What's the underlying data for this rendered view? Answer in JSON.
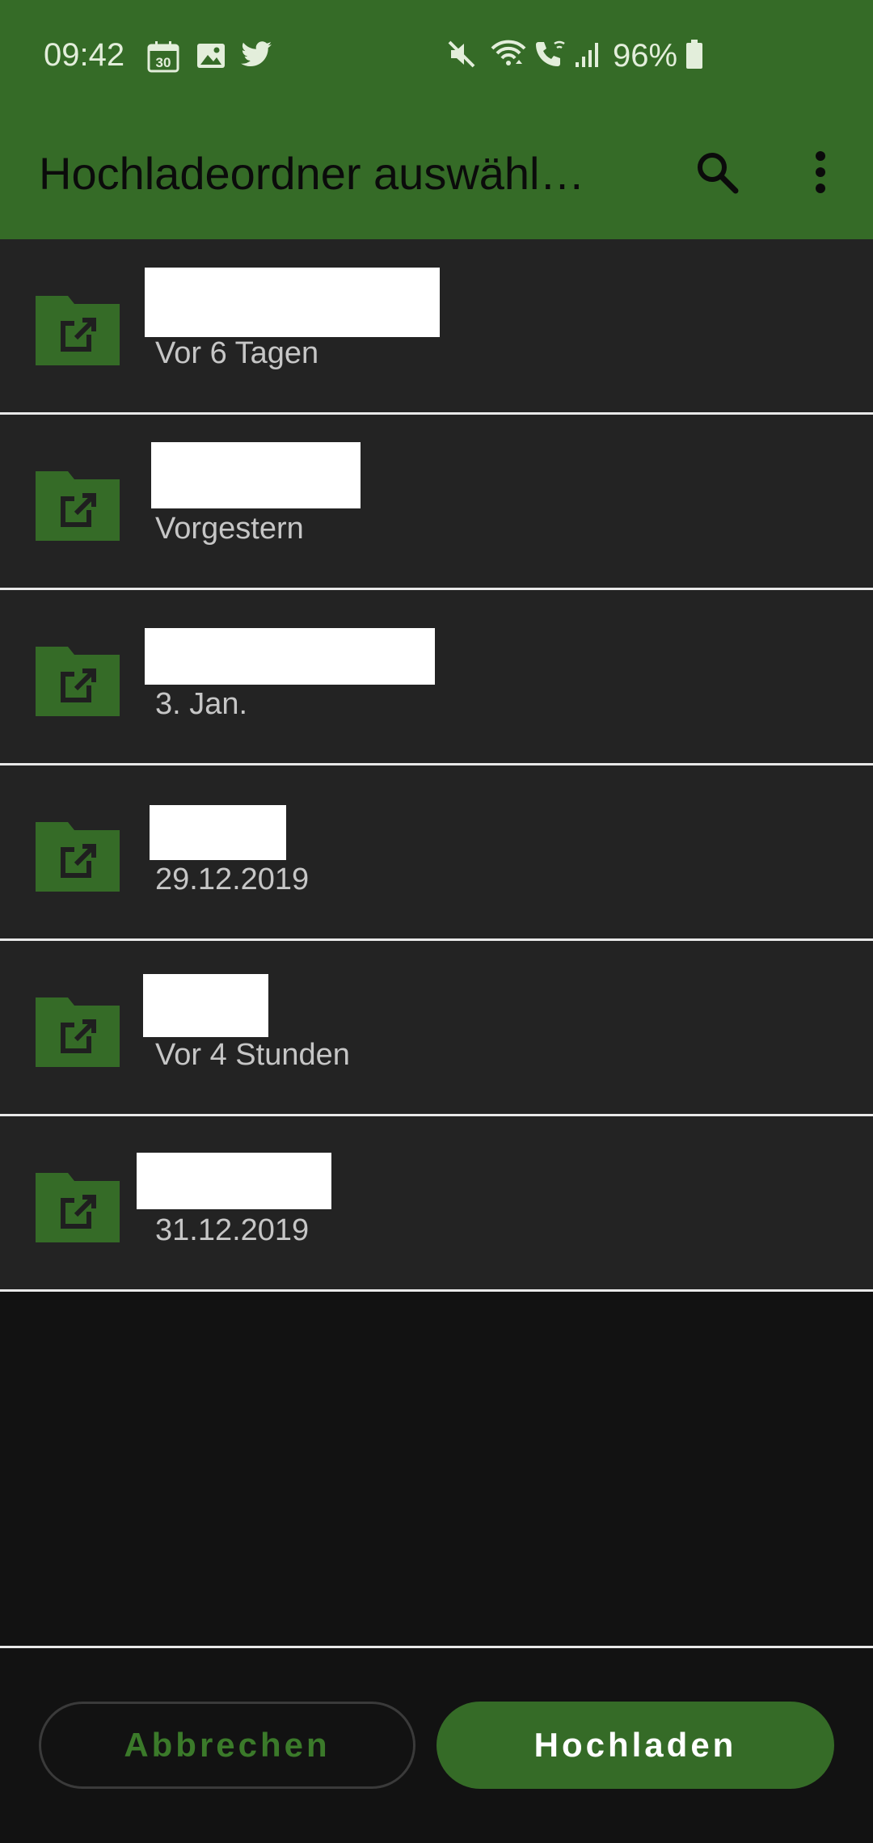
{
  "status_bar": {
    "time": "09:42",
    "calendar_day": "30",
    "battery": "96%",
    "left_icons": [
      "calendar-icon",
      "image-icon",
      "twitter-icon"
    ],
    "right_icons": [
      "mute-icon",
      "wifi-icon",
      "wifi-call-icon",
      "signal-icon",
      "battery-icon"
    ]
  },
  "app_bar": {
    "title": "Hochladeordner auswähl…",
    "actions": [
      "search-icon",
      "more-vert-icon"
    ],
    "background": "#356b27"
  },
  "folders": [
    {
      "name": "",
      "date": "Vor 6 Tagen"
    },
    {
      "name": "",
      "date": "Vorgestern"
    },
    {
      "name": "",
      "date": "3. Jan."
    },
    {
      "name": "",
      "date": "29.12.2019"
    },
    {
      "name": "",
      "date": "Vor 4 Stunden"
    },
    {
      "name": "",
      "date": "31.12.2019"
    }
  ],
  "buttons": {
    "cancel": "Abbrechen",
    "upload": "Hochladen"
  },
  "colors": {
    "accent": "#356b27",
    "row_background": "#232323",
    "page_background": "#121212"
  }
}
